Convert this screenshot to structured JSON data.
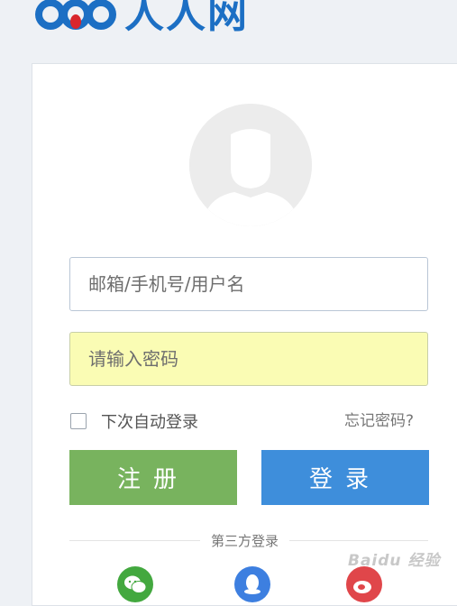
{
  "header": {
    "logo_text": "人人网",
    "brand_color": "#1c6fc4"
  },
  "login_form": {
    "avatar": "default-avatar-icon",
    "username_placeholder": "邮箱/手机号/用户名",
    "password_placeholder": "请输入密码",
    "remember_label": "下次自动登录",
    "remember_checked": false,
    "forgot_link": "忘记密码?",
    "register_label": "注册",
    "login_label": "登录",
    "register_color": "#78b35e",
    "login_color": "#3e8edb"
  },
  "third_party": {
    "label": "第三方登录",
    "providers": [
      {
        "name": "wechat",
        "icon": "wechat-icon",
        "color": "#43a83f"
      },
      {
        "name": "qq",
        "icon": "qq-icon",
        "color": "#3d7fe0"
      },
      {
        "name": "weibo",
        "icon": "weibo-icon",
        "color": "#e0464a"
      }
    ]
  },
  "watermark": "Baidu 经验"
}
